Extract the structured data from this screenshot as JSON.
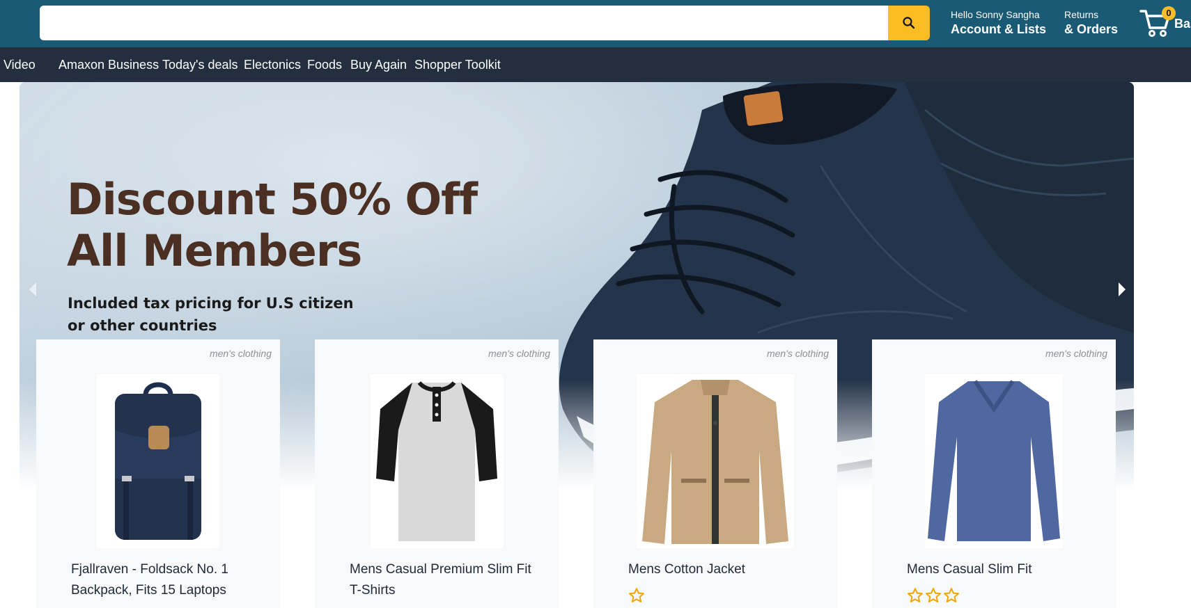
{
  "header": {
    "search": {
      "placeholder": "",
      "value": ""
    },
    "greeting": "Hello Sonny Sangha",
    "account_label": "Account & Lists",
    "returns": "Returns",
    "orders": "& Orders",
    "basket_count": "0",
    "basket_label": "Basket"
  },
  "subnav": {
    "items": [
      "Prime Video",
      "Amaxon Business",
      "Today's deals",
      "Electonics",
      "Foods",
      "Buy Again",
      "Shopper Toolkit"
    ]
  },
  "hero": {
    "title": "Discount 50% Off\nAll Members",
    "subtitle": "Included tax pricing for U.S citizen or other countries"
  },
  "products": [
    {
      "category": "men's clothing",
      "title": "Fjallraven - Foldsack No. 1 Backpack, Fits 15 Laptops",
      "rating": 0,
      "icon": "backpack-icon"
    },
    {
      "category": "men's clothing",
      "title": "Mens Casual Premium Slim Fit T-Shirts",
      "rating": 0,
      "icon": "tshirt-icon"
    },
    {
      "category": "men's clothing",
      "title": "Mens Cotton Jacket",
      "rating": 1,
      "icon": "jacket-icon"
    },
    {
      "category": "men's clothing",
      "title": "Mens Casual Slim Fit",
      "rating": 3,
      "icon": "longsleeve-icon"
    }
  ],
  "colors": {
    "header_bg": "#1b5a74",
    "subnav_bg": "#232f3e",
    "accent": "#fbbd23",
    "hero_title": "#4a2f22"
  }
}
